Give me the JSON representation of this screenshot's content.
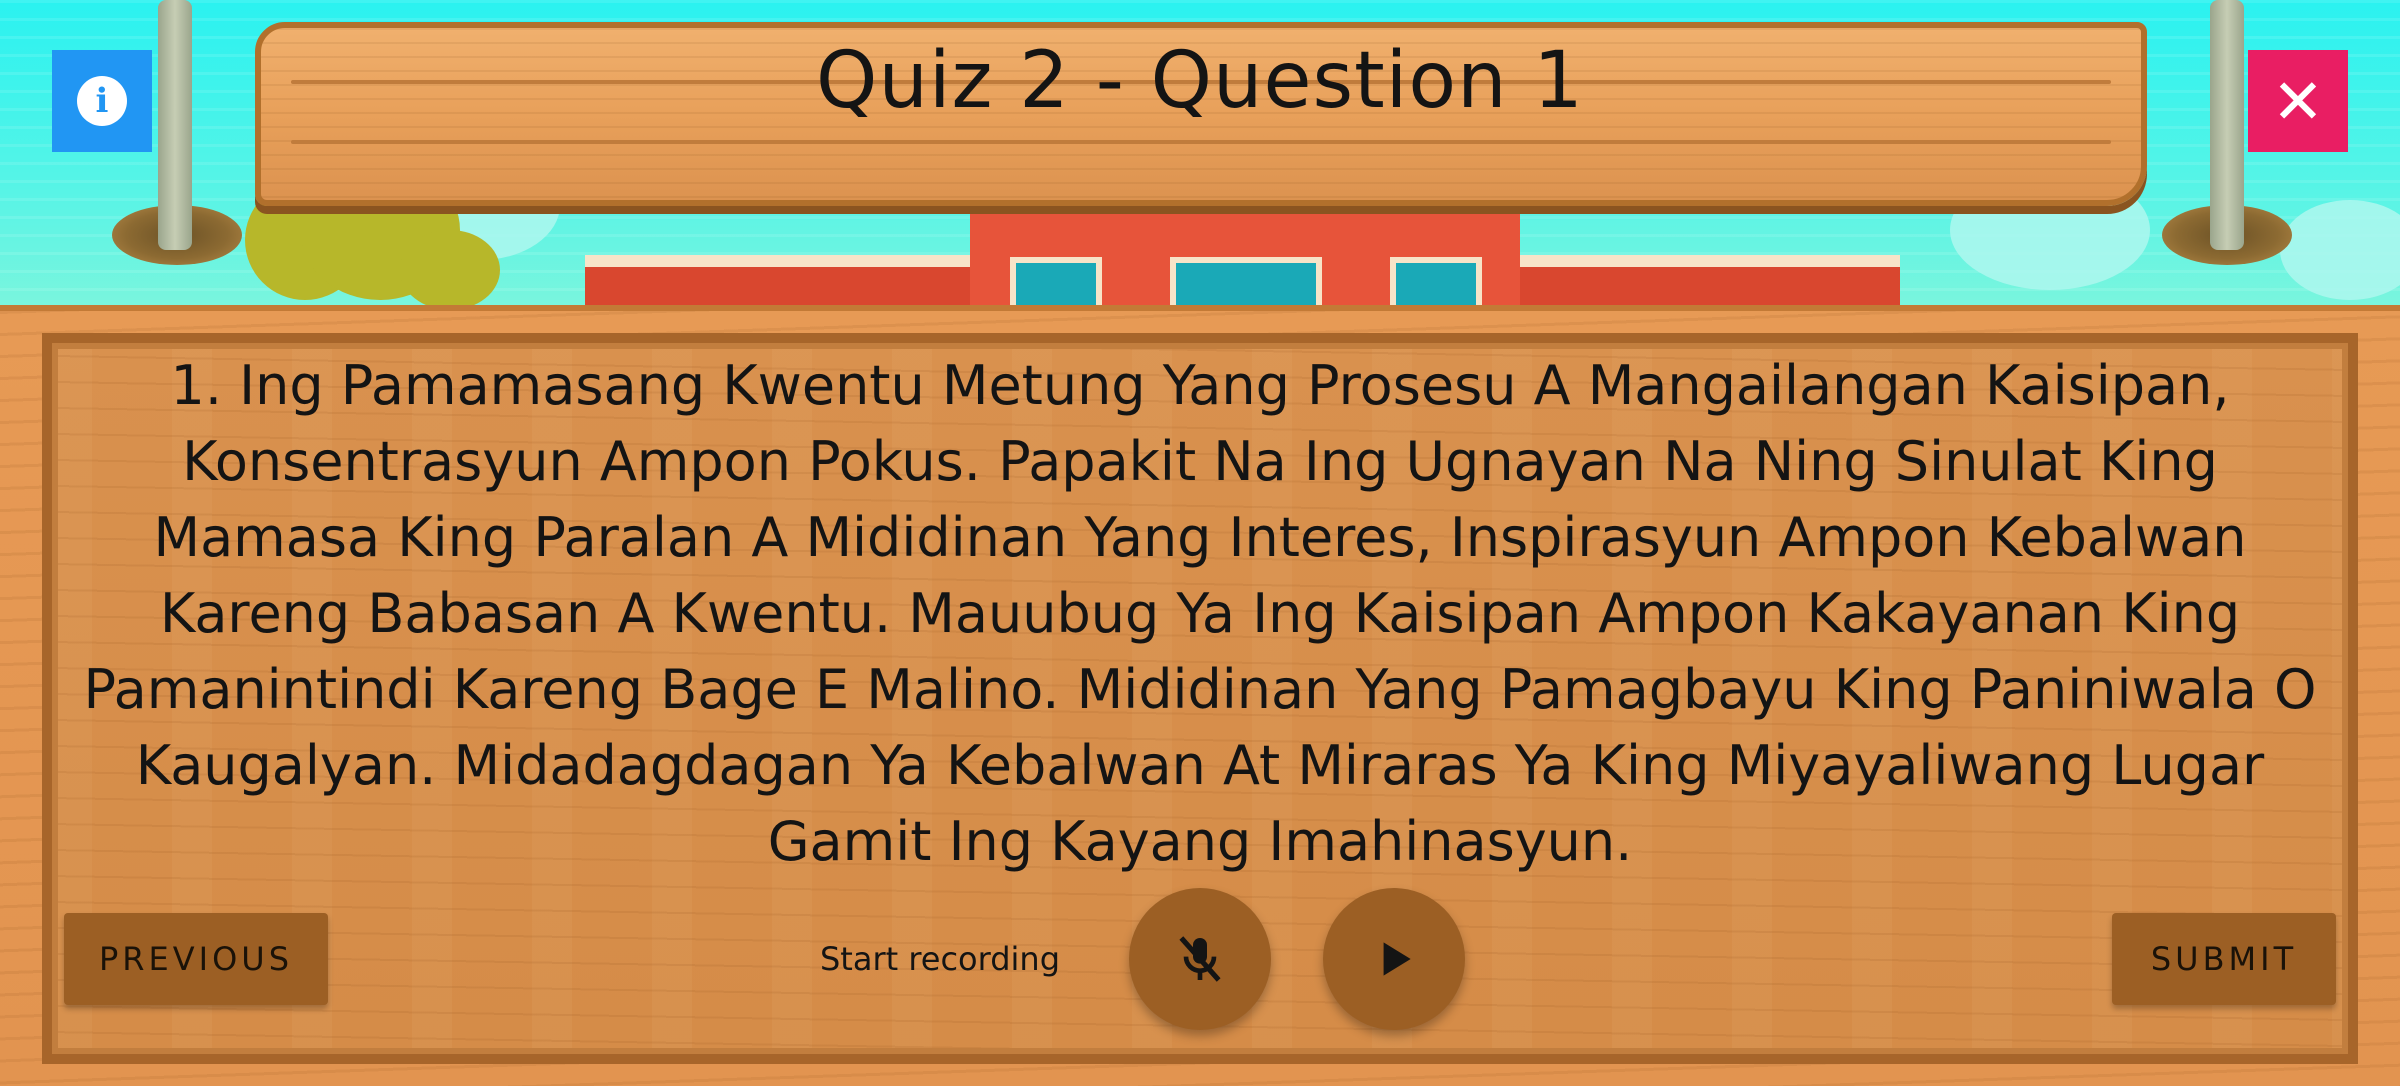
{
  "header": {
    "title": "Quiz 2 - Question 1",
    "info_icon": "info-icon",
    "close_icon": "close-icon",
    "info_color": "#2196f3",
    "close_color": "#e91e63"
  },
  "question": {
    "text": "1. Ing Pamamasang Kwentu Metung Yang Prosesu A Mangailangan Kaisipan, Konsentrasyun Ampon Pokus. Papakit Na Ing Ugnayan Na Ning Sinulat King Mamasa King Paralan A Mididinan Yang Interes, Inspirasyun Ampon Kebalwan Kareng Babasan A Kwentu. Mauubug Ya Ing Kaisipan Ampon Kakayanan King Pamanintindi Kareng Bage E Malino. Mididinan Yang Pamagbayu King Paniniwala O Kaugalyan. Midadagdagan Ya Kebalwan At Miraras Ya King Miyayaliwang Lugar Gamit Ing Kayang Imahinasyun."
  },
  "controls": {
    "previous_label": "PREVIOUS",
    "submit_label": "SUBMIT",
    "recording_label": "Start recording",
    "mic_icon": "mic-off-icon",
    "play_icon": "play-icon",
    "button_color": "#9c5f24"
  }
}
